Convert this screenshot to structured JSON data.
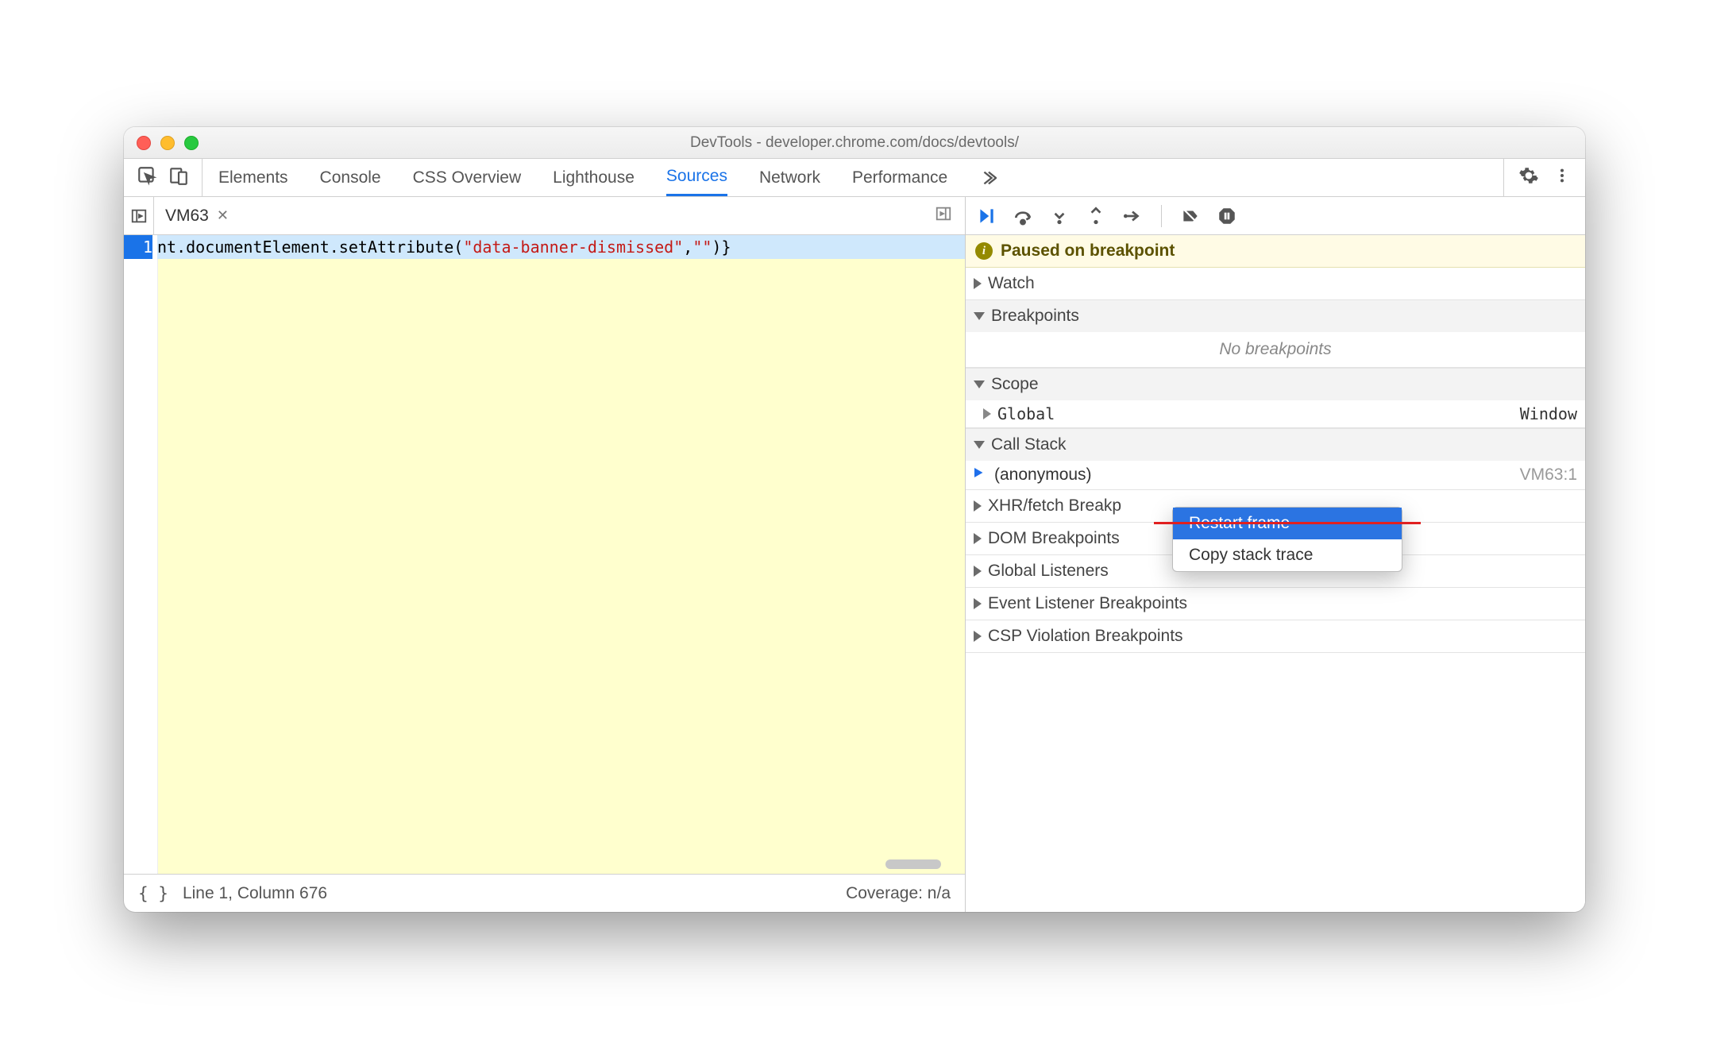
{
  "window_title": "DevTools - developer.chrome.com/docs/devtools/",
  "top_tabs": {
    "items": [
      "Elements",
      "Console",
      "CSS Overview",
      "Lighthouse",
      "Sources",
      "Network",
      "Performance"
    ],
    "active": "Sources"
  },
  "file_tab": {
    "name": "VM63"
  },
  "code": {
    "line_number": "1",
    "prefix": "nt.documentElement.setAttribute(",
    "string_arg1": "\"data-banner-dismissed\"",
    "comma": ",",
    "string_arg2": "\"\"",
    "suffix": ")}"
  },
  "statusbar": {
    "braces": "{ }",
    "position": "Line 1, Column 676",
    "coverage": "Coverage: n/a"
  },
  "paused_label": "Paused on breakpoint",
  "sections": {
    "watch": "Watch",
    "breakpoints": "Breakpoints",
    "no_breakpoints": "No breakpoints",
    "scope": "Scope",
    "scope_global": "Global",
    "scope_global_value": "Window",
    "callstack": "Call Stack",
    "callstack_item": "(anonymous)",
    "callstack_loc": "VM63:1",
    "xhr": "XHR/fetch Breakp",
    "dom": "DOM Breakpoints",
    "global_listeners": "Global Listeners",
    "event_listener": "Event Listener Breakpoints",
    "csp": "CSP Violation Breakpoints"
  },
  "context_menu": {
    "restart": "Restart frame",
    "copy": "Copy stack trace"
  }
}
